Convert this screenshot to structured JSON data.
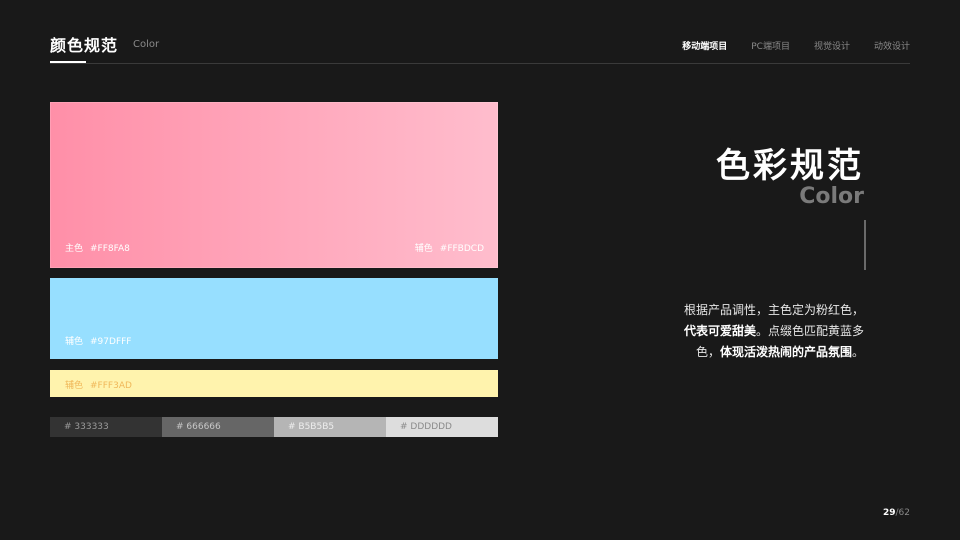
{
  "header": {
    "title": "颜色规范",
    "subtitle": "Color",
    "nav": [
      "移动端项目",
      "PC端项目",
      "视觉设计",
      "动效设计"
    ]
  },
  "swatches": {
    "main": {
      "label": "主色",
      "hex": "#FF8FA8",
      "color": "#FF8FA8"
    },
    "secondary": {
      "label": "辅色",
      "hex": "#FFBDCD",
      "color": "#FFBDCD"
    },
    "blue": {
      "label": "辅色",
      "hex": "#97DFFF",
      "color": "#97DFFF"
    },
    "yellow": {
      "label": "辅色",
      "hex": "#FFF3AD",
      "color": "#FFF3AD"
    },
    "grays": [
      {
        "text": "# 333333",
        "bg": "#333333",
        "fg": "#9a9a9a"
      },
      {
        "text": "# 666666",
        "bg": "#666666",
        "fg": "#c8c8c8"
      },
      {
        "text": "# B5B5B5",
        "bg": "#B5B5B5",
        "fg": "#eeeeee"
      },
      {
        "text": "# DDDDDD",
        "bg": "#DDDDDD",
        "fg": "#8a8a8a"
      }
    ]
  },
  "right": {
    "title": "色彩规范",
    "subtitle": "Color",
    "desc": {
      "line1": "根据产品调性，主色定为粉红色，",
      "line2_bold": "代表可爱甜美",
      "line2_rest": "。点缀色匹配黄蓝多",
      "line3_pre": "色，",
      "line3_bold": "体现活泼热闹的产品氛围",
      "line3_end": "。"
    }
  },
  "page": {
    "current": "29",
    "total": "62"
  }
}
